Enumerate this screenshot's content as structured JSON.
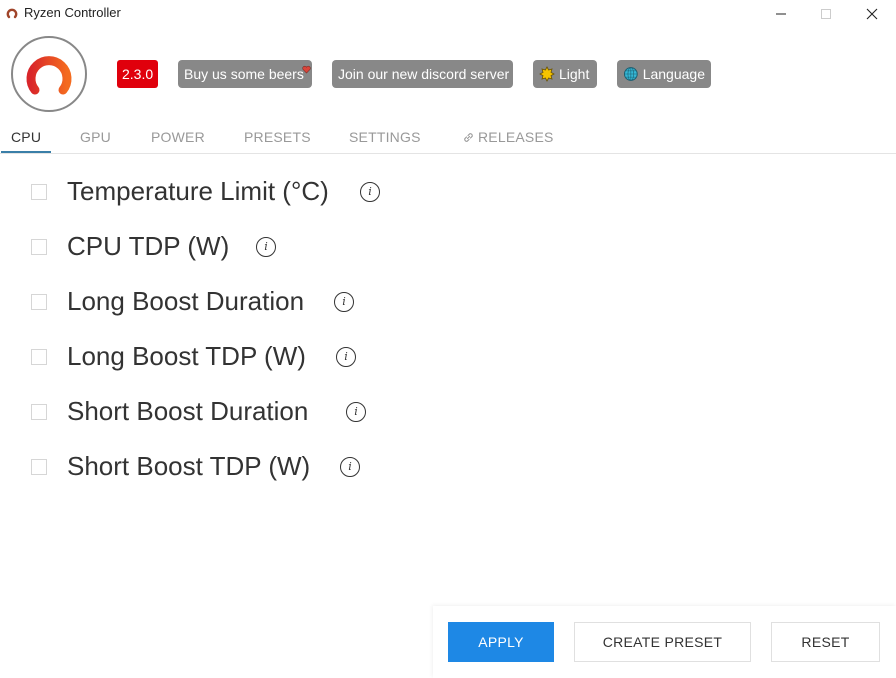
{
  "window": {
    "title": "Ryzen Controller",
    "controls": {
      "minimize": "—",
      "maximize": "☐",
      "close": "✕"
    }
  },
  "header": {
    "version": "2.3.0",
    "buttons": [
      {
        "label": "Buy us some beers",
        "icon": "heart-icon"
      },
      {
        "label": "Join our new discord server"
      },
      {
        "label": "Light",
        "icon": "sun-icon"
      },
      {
        "label": "Language",
        "icon": "globe-icon"
      }
    ]
  },
  "tabs": [
    {
      "label": "CPU",
      "active": true
    },
    {
      "label": "GPU"
    },
    {
      "label": "POWER"
    },
    {
      "label": "PRESETS"
    },
    {
      "label": "SETTINGS"
    },
    {
      "label": "RELEASES",
      "icon": "link-icon"
    }
  ],
  "settings": [
    {
      "label": "Temperature Limit (°C)",
      "checked": false
    },
    {
      "label": "CPU TDP (W)",
      "checked": false
    },
    {
      "label": "Long Boost Duration",
      "checked": false
    },
    {
      "label": "Long Boost TDP (W)",
      "checked": false
    },
    {
      "label": "Short Boost Duration",
      "checked": false
    },
    {
      "label": "Short Boost TDP (W)",
      "checked": false
    }
  ],
  "info_glyph": "i",
  "footer": {
    "apply": "APPLY",
    "create_preset": "CREATE PRESET",
    "reset": "RESET"
  },
  "colors": {
    "accent": "#1e88e5",
    "version_badge": "#e0000c",
    "pill_bg": "#888888"
  }
}
